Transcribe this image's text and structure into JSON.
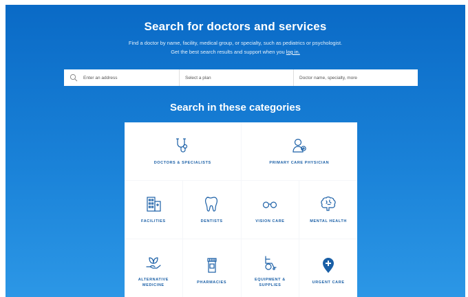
{
  "header": {
    "title": "Search for doctors and services",
    "subtitle_line1": "Find a doctor by name, facility, medical group, or specialty, such as pediatrics or psychologist.",
    "subtitle_line2_prefix": "Get the best search results and support when you ",
    "login_link": "log in."
  },
  "search": {
    "address_placeholder": "Enter an address",
    "plan_placeholder": "Select a plan",
    "doctor_placeholder": "Doctor name, specialty, more"
  },
  "categories": {
    "title": "Search in these categories",
    "items": [
      {
        "label": "DOCTORS & SPECIALISTS",
        "icon": "stethoscope-icon"
      },
      {
        "label": "PRIMARY CARE PHYSICIAN",
        "icon": "physician-icon"
      },
      {
        "label": "FACILITIES",
        "icon": "building-icon"
      },
      {
        "label": "DENTISTS",
        "icon": "tooth-icon"
      },
      {
        "label": "VISION CARE",
        "icon": "glasses-icon"
      },
      {
        "label": "MENTAL HEALTH",
        "icon": "brain-icon"
      },
      {
        "label": "ALTERNATIVE\nMEDICINE",
        "icon": "leaf-hand-icon"
      },
      {
        "label": "PHARMACIES",
        "icon": "pill-bottle-icon"
      },
      {
        "label": "EQUIPMENT &\nSUPPLIES",
        "icon": "wheelchair-icon"
      },
      {
        "label": "URGENT CARE",
        "icon": "location-plus-icon"
      }
    ]
  },
  "colors": {
    "primary": "#0a6ac6",
    "icon": "#1a5fa6",
    "tile_bg": "#ffffff"
  }
}
